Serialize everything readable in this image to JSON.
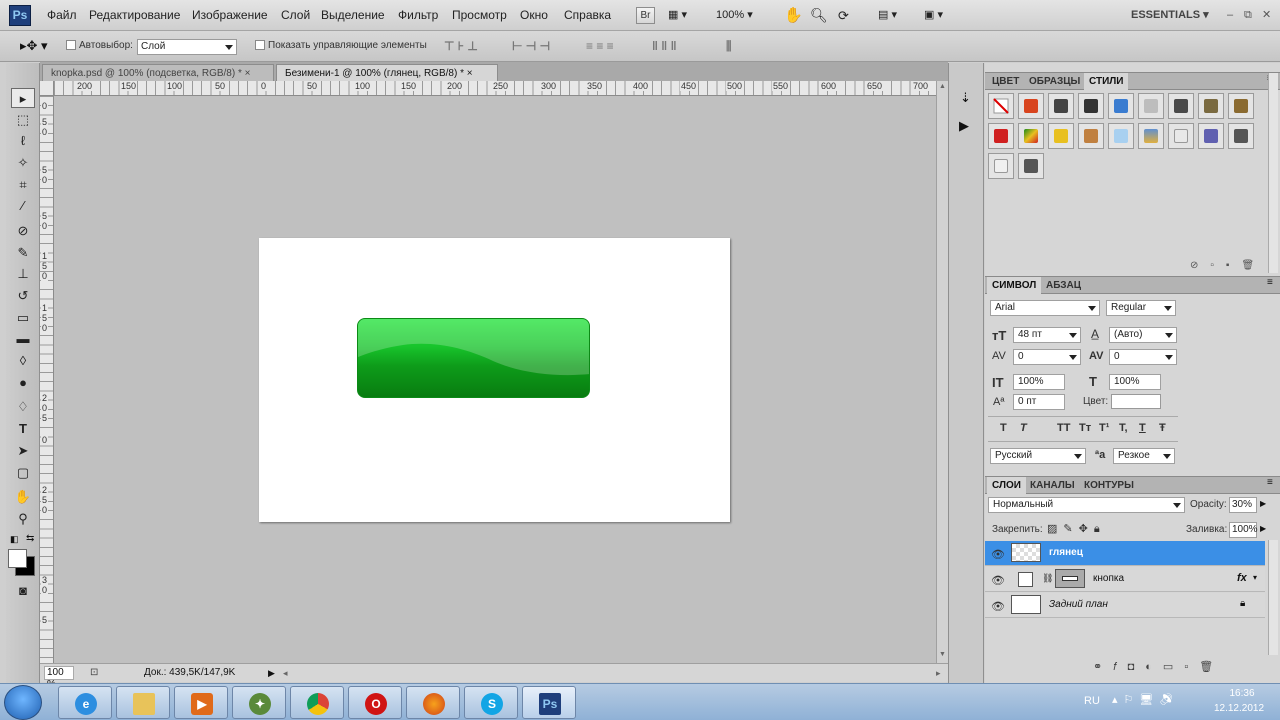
{
  "app": {
    "logo": "Ps"
  },
  "menu": [
    "Файл",
    "Редактирование",
    "Изображение",
    "Слой",
    "Выделение",
    "Фильтр",
    "Просмотр",
    "Окно",
    "Справка"
  ],
  "appbar": {
    "br_label": "Br",
    "zoom": "100%",
    "workspace": "ESSENTIALS"
  },
  "options": {
    "autoselect_label": "Автовыбор:",
    "autoselect_value": "Слой",
    "show_controls_label": "Показать управляющие элементы"
  },
  "tabs": [
    {
      "label": "knopka.psd @ 100% (подсветка, RGB/8) *",
      "close": "×",
      "active": false
    },
    {
      "label": "Безимени-1 @ 100% (глянец, RGB/8) *",
      "close": "×",
      "active": true
    }
  ],
  "ruler_h": [
    "200",
    "150",
    "100",
    "50",
    "0",
    "50",
    "100",
    "150",
    "200",
    "250",
    "300",
    "350",
    "400",
    "450",
    "500",
    "550",
    "600",
    "650",
    "700"
  ],
  "ruler_v": [
    "0",
    "5",
    "0",
    "5",
    "0",
    "5",
    "0",
    "1",
    "5",
    "0",
    "1",
    "5",
    "0",
    "2",
    "0",
    "5",
    "0",
    "2",
    "5",
    "0",
    "3",
    "0",
    "5"
  ],
  "status": {
    "zoom": "100 %",
    "doc": "Док.: 439,5K/147,9K"
  },
  "panels": {
    "styles_tabs": [
      "ЦВЕТ",
      "ОБРАЗЦЫ",
      "СТИЛИ"
    ],
    "styles_active": "СТИЛИ",
    "styles_colors": [
      "#ffffff",
      "#d8441e",
      "#444444",
      "#333333",
      "#3a7cd0",
      "#bdbdbd",
      "#4a4a4a",
      "#7a6a40",
      "#8a6a30",
      "#d02020",
      "#1a8a1a",
      "#e8c020",
      "#c08040",
      "#a8d0f0",
      "#6090d0",
      "#e8e8e8",
      "#6060b0",
      "#555555",
      "#f0f0f0",
      "#555555"
    ],
    "char_tabs": [
      "СИМВОЛ",
      "АБЗАЦ"
    ],
    "char": {
      "font": "Arial",
      "style": "Regular",
      "size": "48 пт",
      "leading": "(Авто)",
      "kerning": "0",
      "tracking": "0",
      "vscale": "100%",
      "hscale": "100%",
      "baseline": "0 пт",
      "color_label": "Цвет:",
      "type_buttons": [
        "T",
        "T",
        "TT",
        "Tт",
        "T¹",
        "T,",
        "T",
        "Ŧ"
      ],
      "language": "Русский",
      "aa_label": "ªa",
      "aa_value": "Резкое"
    },
    "layers_tabs": [
      "СЛОИ",
      "КАНАЛЫ",
      "КОНТУРЫ"
    ],
    "layers": {
      "blend": "Нормальный",
      "opacity_label": "Opacity:",
      "opacity": "30%",
      "lock_label": "Закрепить:",
      "fill_label": "Заливка:",
      "fill": "100%",
      "items": [
        {
          "name": "глянец",
          "selected": true
        },
        {
          "name": "кнопка",
          "fx": "fx"
        },
        {
          "name": "Задний план",
          "locked": true
        }
      ]
    }
  },
  "taskbar": {
    "lang": "RU",
    "time": "16:36",
    "date": "12.12.2012"
  }
}
